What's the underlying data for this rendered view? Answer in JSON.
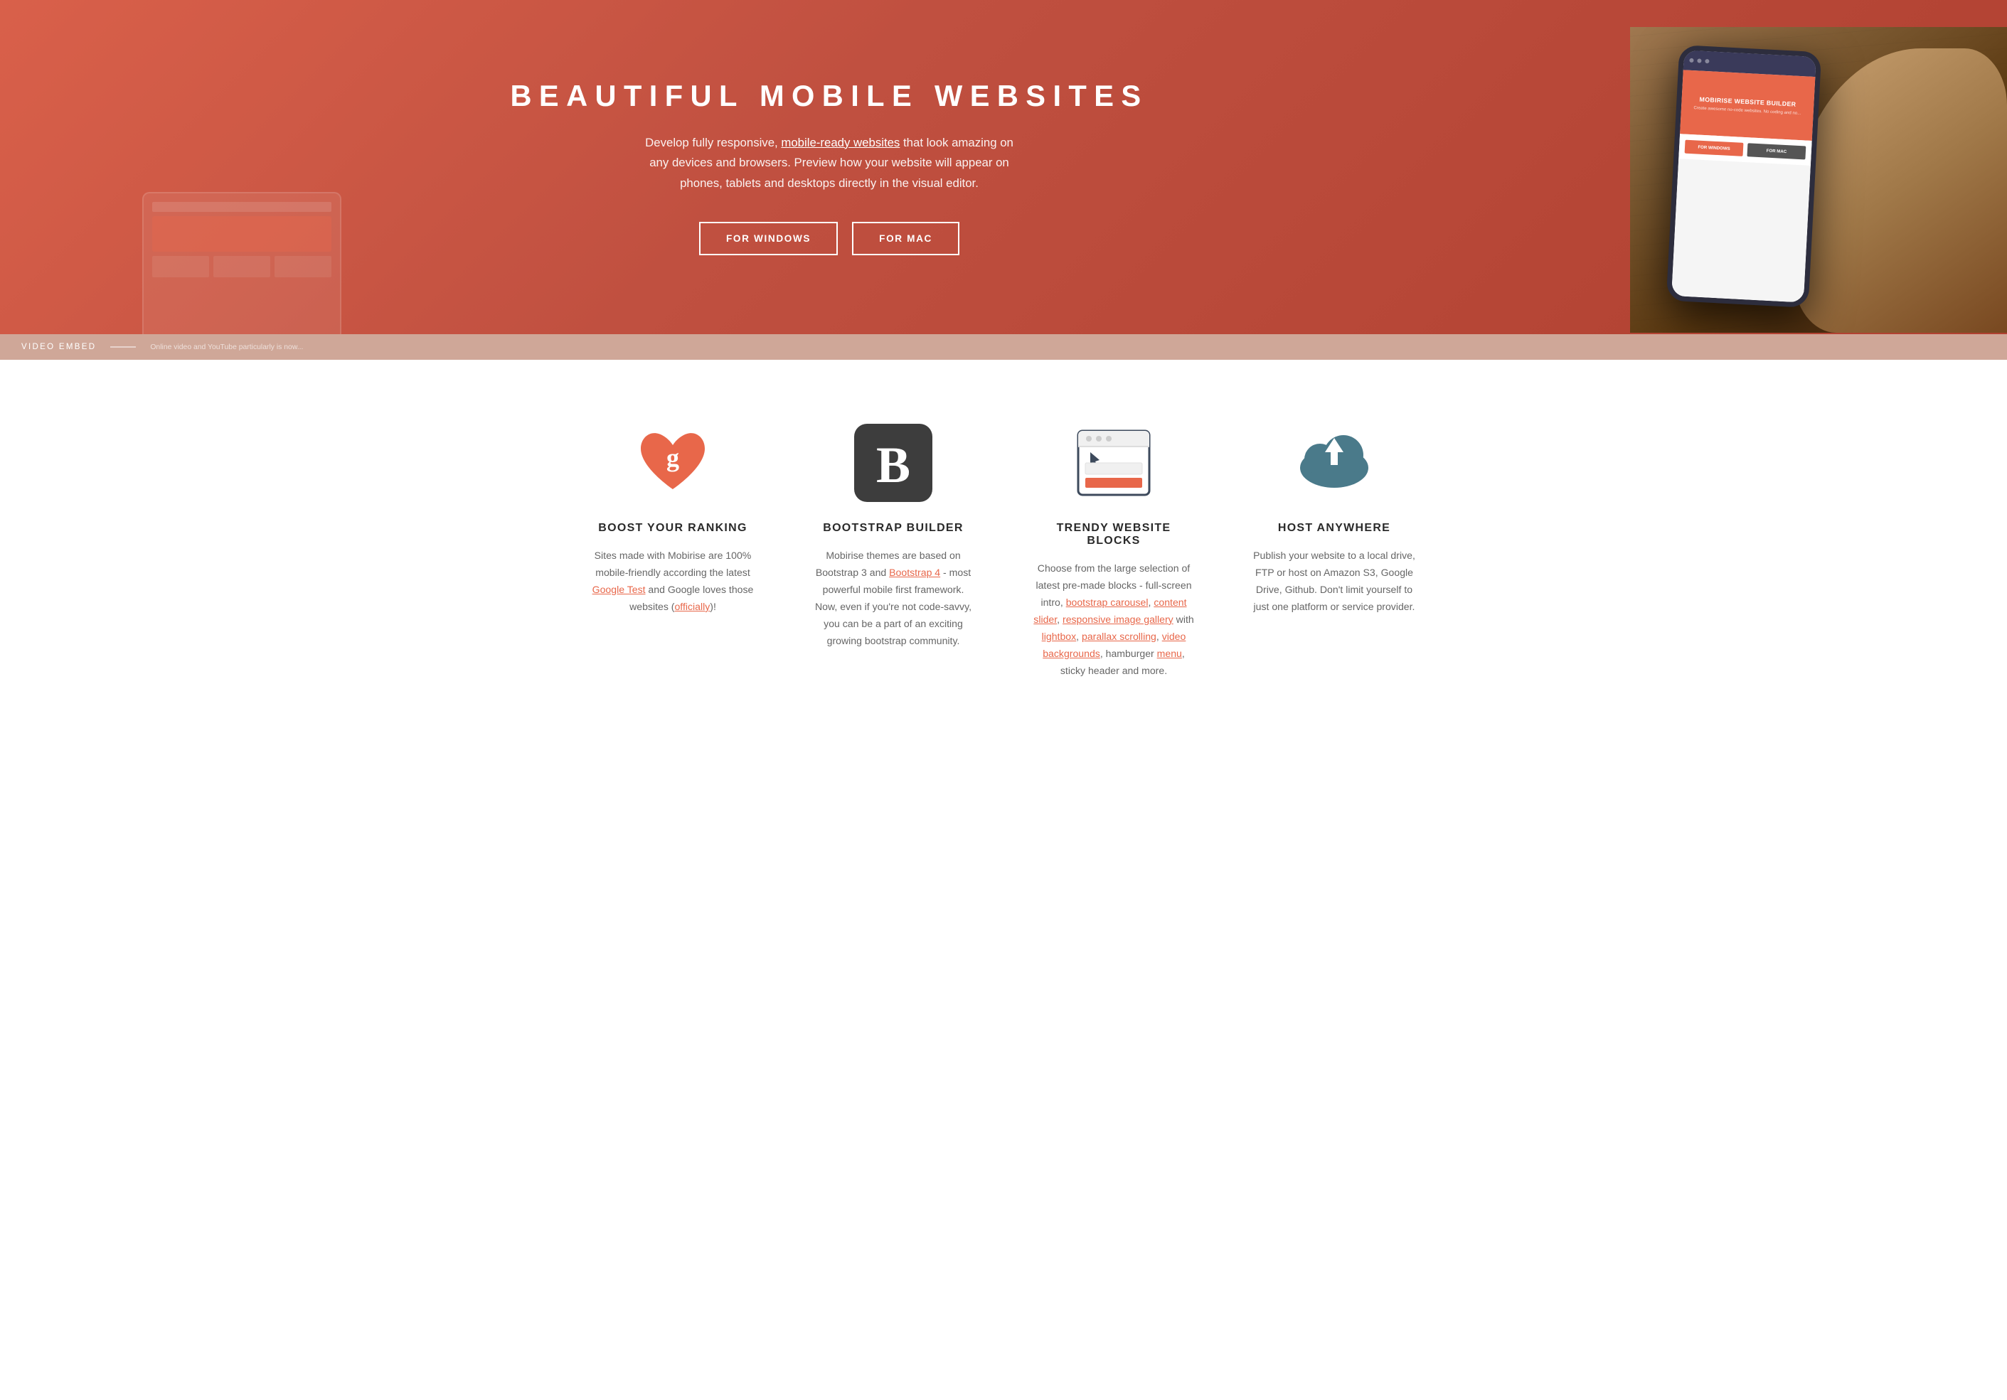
{
  "hero": {
    "title": "BEAUTIFUL MOBILE WEBSITES",
    "description": "Develop fully responsive,",
    "link_text": "mobile-ready websites",
    "description_cont": "that look amazing on any devices and browsers. Preview how your website will appear on phones, tablets and desktops directly in the visual editor.",
    "btn_windows": "FOR WINDOWS",
    "btn_mac": "FOR MAC",
    "phone_screen": {
      "title": "MOBIRISE WEBSITE BUILDER",
      "subtitle": "Create awesome no-code websites. No coding and no..."
    }
  },
  "video_bar": {
    "label": "VIDEO EMBED",
    "description": "Online video and YouTube particularly is now..."
  },
  "features": {
    "items": [
      {
        "id": "boost-ranking",
        "icon": "heart-google",
        "title": "BOOST YOUR RANKING",
        "description": "Sites made with Mobirise are 100% mobile-friendly according the latest ",
        "link1_text": "Google Test",
        "link1_url": "#",
        "description2": " and Google loves those websites (",
        "link2_text": "officially",
        "link2_url": "#",
        "description3": ")!"
      },
      {
        "id": "bootstrap-builder",
        "icon": "bootstrap-b",
        "title": "BOOTSTRAP BUILDER",
        "description": "Mobirise themes are based on Bootstrap 3 and ",
        "link1_text": "Bootstrap 4",
        "link1_url": "#",
        "description2": " - most powerful mobile first framework. Now, even if you're not code-savvy, you can be a part of an exciting growing bootstrap community."
      },
      {
        "id": "trendy-blocks",
        "icon": "browser-blocks",
        "title": "TRENDY WEBSITE BLOCKS",
        "description": "Choose from the large selection of latest pre-made blocks - full-screen intro, ",
        "link1_text": "bootstrap carousel",
        "link1_url": "#",
        "description2": ", ",
        "link2_text": "content slider",
        "link2_url": "#",
        "description3": ", ",
        "link3_text": "responsive image gallery",
        "link3_url": "#",
        "description4": " with ",
        "link4_text": "lightbox",
        "link4_url": "#",
        "description5": ", ",
        "link5_text": "parallax scrolling",
        "link5_url": "#",
        "description6": ", ",
        "link6_text": "video backgrounds",
        "link6_url": "#",
        "description7": ", hamburger ",
        "link7_text": "menu",
        "link7_url": "#",
        "description8": ", sticky header and more."
      },
      {
        "id": "host-anywhere",
        "icon": "cloud-upload",
        "title": "HOST ANYWHERE",
        "description": "Publish your website to a local drive, FTP or host on Amazon S3, Google Drive, Github. Don't limit yourself to just one platform or service provider."
      }
    ]
  },
  "colors": {
    "hero_bg": "#e8674a",
    "hero_overlay": "rgba(200,80,50,0.5)",
    "btn_border": "#ffffff",
    "feature_title": "#2a2a2a",
    "feature_text": "#666666",
    "link_color": "#e8674a",
    "bootstrap_bg": "#3d3d3d",
    "cloud_color": "#4a7a8a",
    "browser_border": "#3d4a5c"
  }
}
